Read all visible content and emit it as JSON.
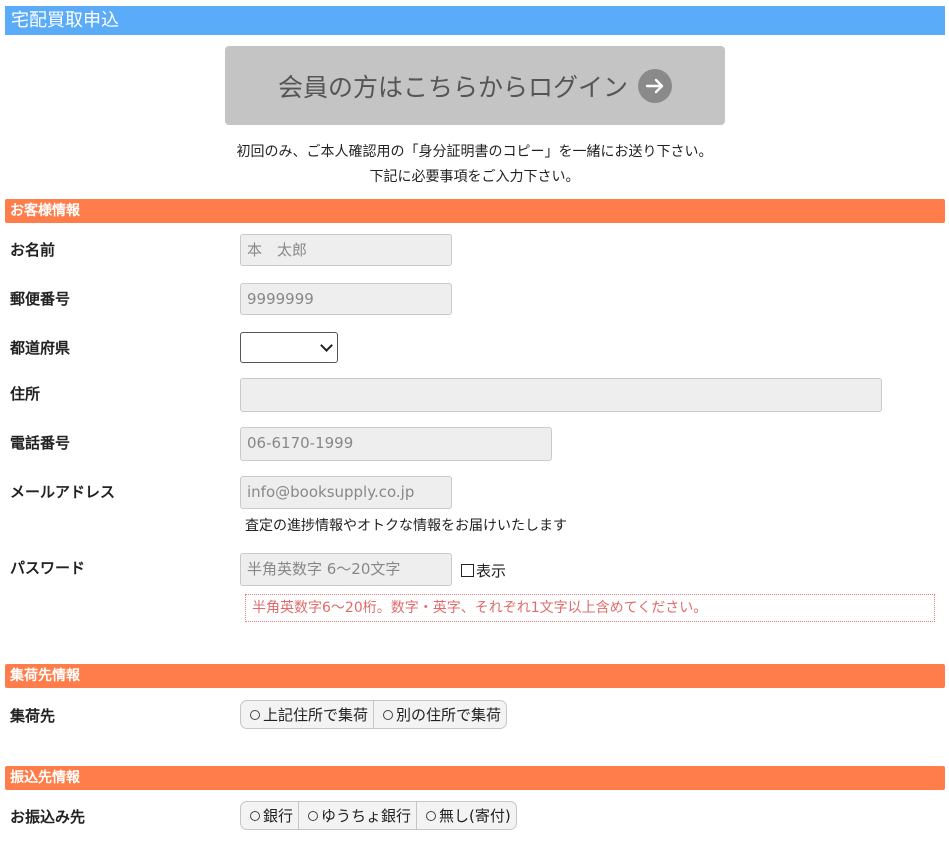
{
  "page": {
    "title": "宅配買取申込"
  },
  "login": {
    "label": "会員の方はこちらからログイン"
  },
  "notices": {
    "line1": "初回のみ、ご本人確認用の「身分証明書のコピー」を一緒にお送り下さい。",
    "line2": "下記に必要事項をご入力下さい。"
  },
  "customer": {
    "section_title": "お客様情報",
    "name_label": "お名前",
    "name_placeholder": "本　太郎",
    "postal_label": "郵便番号",
    "postal_placeholder": "9999999",
    "prefecture_label": "都道府県",
    "prefecture_value": "",
    "address_label": "住所",
    "address_placeholder": "",
    "phone_label": "電話番号",
    "phone_placeholder": "06-6170-1999",
    "email_label": "メールアドレス",
    "email_placeholder": "info@booksupply.co.jp",
    "email_hint": "査定の進捗情報やオトクな情報をお届けいたします",
    "password_label": "パスワード",
    "password_placeholder": "半角英数字 6～20文字",
    "show_label": "表示",
    "password_rule": "半角英数字6～20桁。数字・英字、それぞれ1文字以上含めてください。"
  },
  "pickup": {
    "section_title": "集荷先情報",
    "label": "集荷先",
    "options": [
      "上記住所で集荷",
      "別の住所で集荷"
    ]
  },
  "transfer": {
    "section_title": "振込先情報",
    "label": "お振込み先",
    "options": [
      "銀行",
      "ゆうちょ銀行",
      "無し(寄付)"
    ]
  },
  "colors": {
    "title_bar": "#5aacf8",
    "section_bar": "#ff7d4a",
    "login_button": "#c4c4c4",
    "warning_text": "#e06b6b"
  }
}
